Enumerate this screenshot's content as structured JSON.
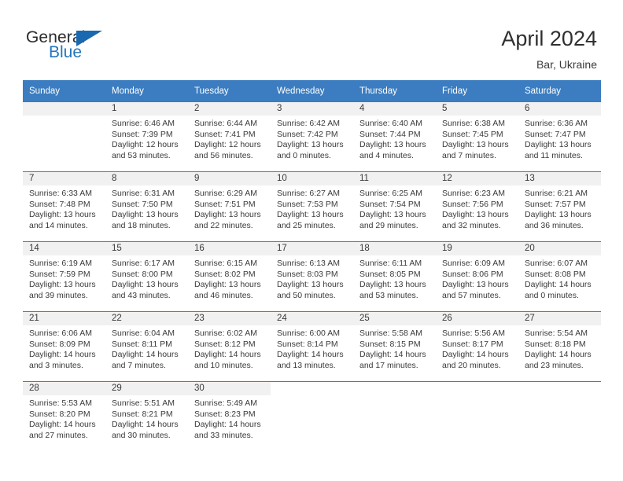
{
  "brand": {
    "name_part1": "General",
    "name_part2": "Blue",
    "flag_color": "#1a69b0",
    "text_color": "#2b2b2b",
    "blue_color": "#2476bd"
  },
  "header": {
    "title": "April 2024",
    "subtitle": "Bar, Ukraine"
  },
  "theme": {
    "header_bg": "#3b7dc0",
    "header_text": "#ffffff",
    "daynum_bg": "#f1f1f1",
    "cell_bg": "#ffffff",
    "rule_color": "#3b7dc0"
  },
  "columns": [
    "Sunday",
    "Monday",
    "Tuesday",
    "Wednesday",
    "Thursday",
    "Friday",
    "Saturday"
  ],
  "weeks": [
    [
      {
        "day": "",
        "lines": []
      },
      {
        "day": "1",
        "lines": [
          "Sunrise: 6:46 AM",
          "Sunset: 7:39 PM",
          "Daylight: 12 hours",
          "and 53 minutes."
        ]
      },
      {
        "day": "2",
        "lines": [
          "Sunrise: 6:44 AM",
          "Sunset: 7:41 PM",
          "Daylight: 12 hours",
          "and 56 minutes."
        ]
      },
      {
        "day": "3",
        "lines": [
          "Sunrise: 6:42 AM",
          "Sunset: 7:42 PM",
          "Daylight: 13 hours",
          "and 0 minutes."
        ]
      },
      {
        "day": "4",
        "lines": [
          "Sunrise: 6:40 AM",
          "Sunset: 7:44 PM",
          "Daylight: 13 hours",
          "and 4 minutes."
        ]
      },
      {
        "day": "5",
        "lines": [
          "Sunrise: 6:38 AM",
          "Sunset: 7:45 PM",
          "Daylight: 13 hours",
          "and 7 minutes."
        ]
      },
      {
        "day": "6",
        "lines": [
          "Sunrise: 6:36 AM",
          "Sunset: 7:47 PM",
          "Daylight: 13 hours",
          "and 11 minutes."
        ]
      }
    ],
    [
      {
        "day": "7",
        "lines": [
          "Sunrise: 6:33 AM",
          "Sunset: 7:48 PM",
          "Daylight: 13 hours",
          "and 14 minutes."
        ]
      },
      {
        "day": "8",
        "lines": [
          "Sunrise: 6:31 AM",
          "Sunset: 7:50 PM",
          "Daylight: 13 hours",
          "and 18 minutes."
        ]
      },
      {
        "day": "9",
        "lines": [
          "Sunrise: 6:29 AM",
          "Sunset: 7:51 PM",
          "Daylight: 13 hours",
          "and 22 minutes."
        ]
      },
      {
        "day": "10",
        "lines": [
          "Sunrise: 6:27 AM",
          "Sunset: 7:53 PM",
          "Daylight: 13 hours",
          "and 25 minutes."
        ]
      },
      {
        "day": "11",
        "lines": [
          "Sunrise: 6:25 AM",
          "Sunset: 7:54 PM",
          "Daylight: 13 hours",
          "and 29 minutes."
        ]
      },
      {
        "day": "12",
        "lines": [
          "Sunrise: 6:23 AM",
          "Sunset: 7:56 PM",
          "Daylight: 13 hours",
          "and 32 minutes."
        ]
      },
      {
        "day": "13",
        "lines": [
          "Sunrise: 6:21 AM",
          "Sunset: 7:57 PM",
          "Daylight: 13 hours",
          "and 36 minutes."
        ]
      }
    ],
    [
      {
        "day": "14",
        "lines": [
          "Sunrise: 6:19 AM",
          "Sunset: 7:59 PM",
          "Daylight: 13 hours",
          "and 39 minutes."
        ]
      },
      {
        "day": "15",
        "lines": [
          "Sunrise: 6:17 AM",
          "Sunset: 8:00 PM",
          "Daylight: 13 hours",
          "and 43 minutes."
        ]
      },
      {
        "day": "16",
        "lines": [
          "Sunrise: 6:15 AM",
          "Sunset: 8:02 PM",
          "Daylight: 13 hours",
          "and 46 minutes."
        ]
      },
      {
        "day": "17",
        "lines": [
          "Sunrise: 6:13 AM",
          "Sunset: 8:03 PM",
          "Daylight: 13 hours",
          "and 50 minutes."
        ]
      },
      {
        "day": "18",
        "lines": [
          "Sunrise: 6:11 AM",
          "Sunset: 8:05 PM",
          "Daylight: 13 hours",
          "and 53 minutes."
        ]
      },
      {
        "day": "19",
        "lines": [
          "Sunrise: 6:09 AM",
          "Sunset: 8:06 PM",
          "Daylight: 13 hours",
          "and 57 minutes."
        ]
      },
      {
        "day": "20",
        "lines": [
          "Sunrise: 6:07 AM",
          "Sunset: 8:08 PM",
          "Daylight: 14 hours",
          "and 0 minutes."
        ]
      }
    ],
    [
      {
        "day": "21",
        "lines": [
          "Sunrise: 6:06 AM",
          "Sunset: 8:09 PM",
          "Daylight: 14 hours",
          "and 3 minutes."
        ]
      },
      {
        "day": "22",
        "lines": [
          "Sunrise: 6:04 AM",
          "Sunset: 8:11 PM",
          "Daylight: 14 hours",
          "and 7 minutes."
        ]
      },
      {
        "day": "23",
        "lines": [
          "Sunrise: 6:02 AM",
          "Sunset: 8:12 PM",
          "Daylight: 14 hours",
          "and 10 minutes."
        ]
      },
      {
        "day": "24",
        "lines": [
          "Sunrise: 6:00 AM",
          "Sunset: 8:14 PM",
          "Daylight: 14 hours",
          "and 13 minutes."
        ]
      },
      {
        "day": "25",
        "lines": [
          "Sunrise: 5:58 AM",
          "Sunset: 8:15 PM",
          "Daylight: 14 hours",
          "and 17 minutes."
        ]
      },
      {
        "day": "26",
        "lines": [
          "Sunrise: 5:56 AM",
          "Sunset: 8:17 PM",
          "Daylight: 14 hours",
          "and 20 minutes."
        ]
      },
      {
        "day": "27",
        "lines": [
          "Sunrise: 5:54 AM",
          "Sunset: 8:18 PM",
          "Daylight: 14 hours",
          "and 23 minutes."
        ]
      }
    ],
    [
      {
        "day": "28",
        "lines": [
          "Sunrise: 5:53 AM",
          "Sunset: 8:20 PM",
          "Daylight: 14 hours",
          "and 27 minutes."
        ]
      },
      {
        "day": "29",
        "lines": [
          "Sunrise: 5:51 AM",
          "Sunset: 8:21 PM",
          "Daylight: 14 hours",
          "and 30 minutes."
        ]
      },
      {
        "day": "30",
        "lines": [
          "Sunrise: 5:49 AM",
          "Sunset: 8:23 PM",
          "Daylight: 14 hours",
          "and 33 minutes."
        ]
      },
      {
        "day": "",
        "lines": []
      },
      {
        "day": "",
        "lines": []
      },
      {
        "day": "",
        "lines": []
      },
      {
        "day": "",
        "lines": []
      }
    ]
  ]
}
